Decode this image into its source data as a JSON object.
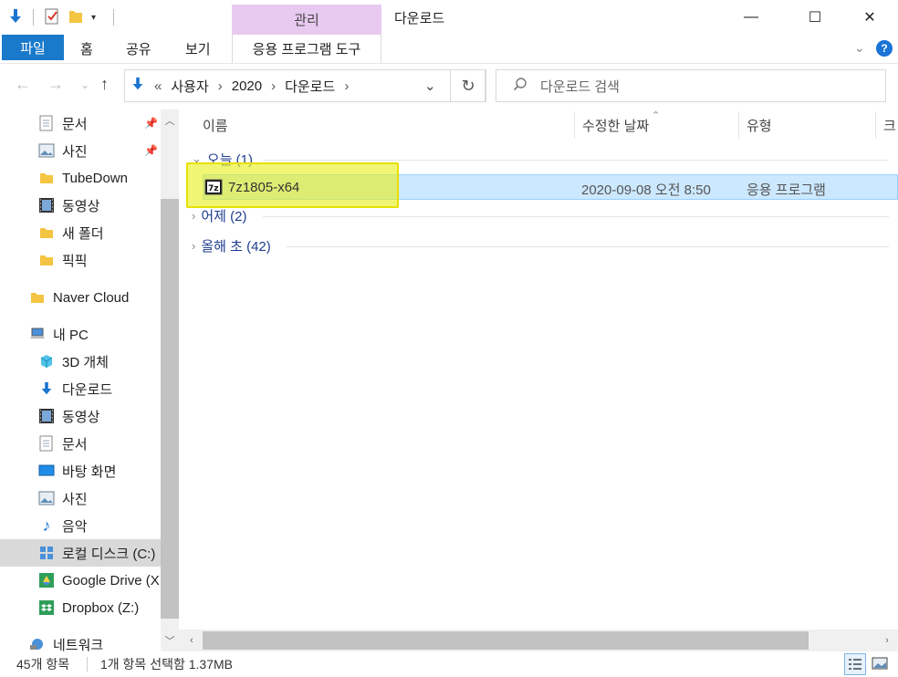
{
  "titlebar": {
    "contextual_tab": "관리",
    "title": "다운로드",
    "minimize": "—",
    "maximize": "☐",
    "close": "✕"
  },
  "ribbon": {
    "file": "파일",
    "home": "홈",
    "share": "공유",
    "view": "보기",
    "app_tools": "응용 프로그램 도구",
    "help": "?"
  },
  "address": {
    "chevrons": "«",
    "segments": [
      "사용자",
      "2020",
      "다운로드"
    ],
    "search_placeholder": "다운로드 검색"
  },
  "nav": {
    "quick_access": [
      {
        "label": "문서",
        "icon": "document-icon",
        "pinned": true
      },
      {
        "label": "사진",
        "icon": "pictures-icon",
        "pinned": true
      },
      {
        "label": "TubeDown",
        "icon": "folder-icon"
      },
      {
        "label": "동영상",
        "icon": "video-icon"
      },
      {
        "label": "새 폴더",
        "icon": "folder-icon"
      },
      {
        "label": "픽픽",
        "icon": "folder-icon"
      }
    ],
    "naver_cloud": "Naver Cloud",
    "this_pc": "내 PC",
    "pc_items": [
      {
        "label": "3D 개체",
        "icon": "3d-objects-icon"
      },
      {
        "label": "다운로드",
        "icon": "downloads-icon"
      },
      {
        "label": "동영상",
        "icon": "video-icon"
      },
      {
        "label": "문서",
        "icon": "document-icon"
      },
      {
        "label": "바탕 화면",
        "icon": "desktop-icon"
      },
      {
        "label": "사진",
        "icon": "pictures-icon"
      },
      {
        "label": "음악",
        "icon": "music-icon"
      },
      {
        "label": "로컬 디스크 (C:)",
        "icon": "drive-icon"
      },
      {
        "label": "Google Drive (X",
        "icon": "google-drive-icon"
      },
      {
        "label": "Dropbox (Z:)",
        "icon": "dropbox-icon"
      }
    ],
    "network": "네트워크"
  },
  "columns": {
    "name": "이름",
    "date": "수정한 날짜",
    "type": "유형",
    "size": "크"
  },
  "groups": [
    {
      "label": "오늘 (1)",
      "expanded": true
    },
    {
      "label": "어제 (2)",
      "expanded": false
    },
    {
      "label": "올해 초 (42)",
      "expanded": false
    }
  ],
  "files": [
    {
      "name": "7z1805-x64",
      "date": "2020-09-08 오전 8:50",
      "type": "응용 프로그램",
      "icon": "7zip-installer-icon"
    }
  ],
  "status": {
    "count": "45개 항목",
    "selection": "1개 항목 선택함 1.37MB"
  },
  "colors": {
    "file_tab": "#1979ca",
    "contextual_tab": "#e8c9f0",
    "selection": "#cce8ff",
    "highlight": "#e6f01e"
  }
}
